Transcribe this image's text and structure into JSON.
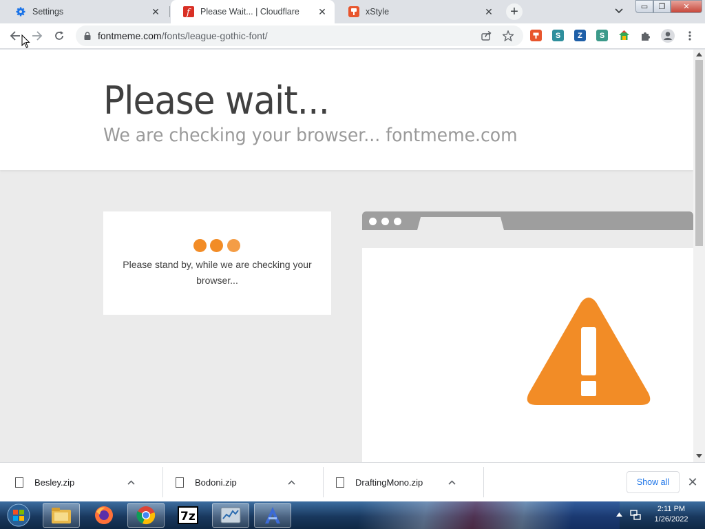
{
  "tabs": [
    {
      "title": "Settings",
      "icon": "gear-icon",
      "active": false
    },
    {
      "title": "Please Wait... | Cloudflare",
      "icon": "fontmeme-favicon-icon",
      "active": true
    },
    {
      "title": "xStyle",
      "icon": "xstyle-favicon-icon",
      "active": false
    }
  ],
  "toolbar": {
    "url_host": "fontmeme.com",
    "url_path": "/fonts/league-gothic-font/"
  },
  "page": {
    "heading": "Please wait...",
    "subheading": "We are checking your browser... fontmeme.com",
    "standby_text": "Please stand by, while we are checking your browser...",
    "accent_color": "#f28c26"
  },
  "downloads": {
    "items": [
      {
        "name": "Besley.zip"
      },
      {
        "name": "Bodoni.zip"
      },
      {
        "name": "DraftingMono.zip"
      }
    ],
    "show_all_label": "Show all"
  },
  "taskbar": {
    "apps": [
      "windows-start-icon",
      "file-explorer-icon",
      "firefox-icon",
      "chrome-icon",
      "7zip-icon",
      "task-manager-icon",
      "font-app-icon"
    ],
    "time": "2:11 PM",
    "date": "1/26/2022"
  }
}
